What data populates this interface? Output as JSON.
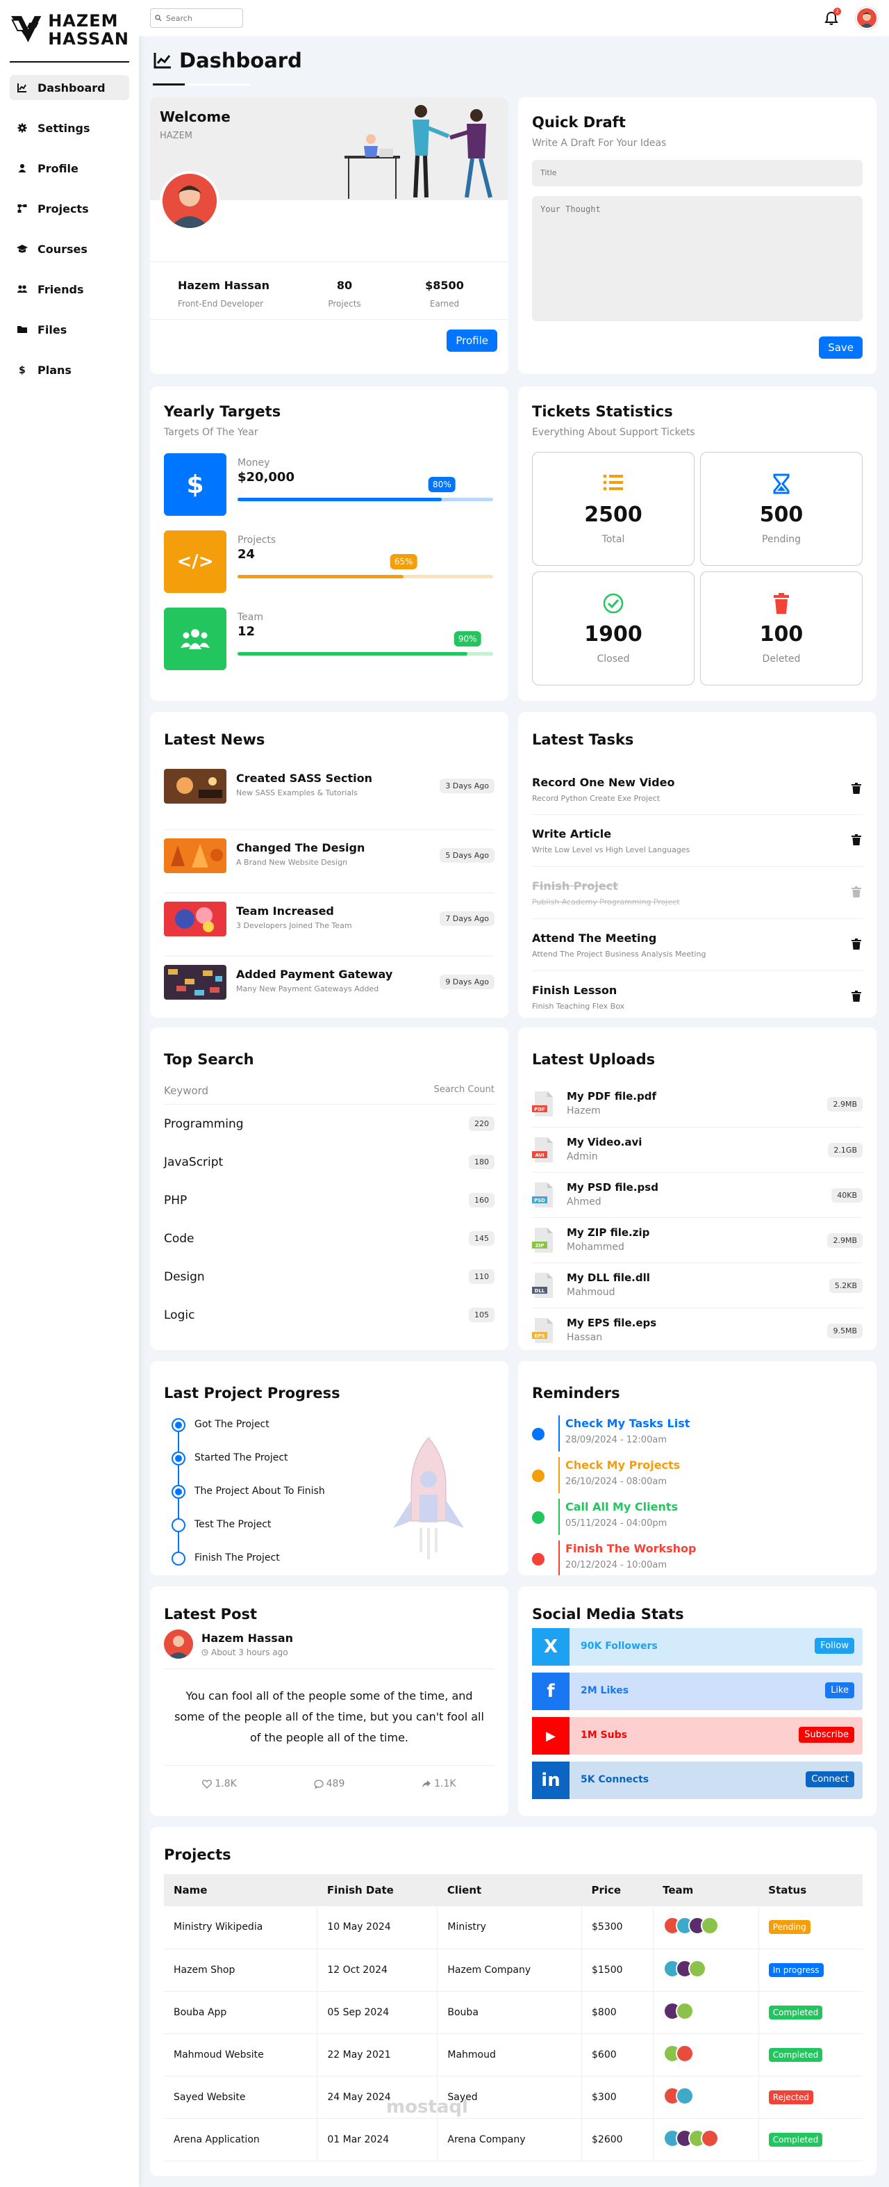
{
  "brand": {
    "line1": "HAZEM",
    "line2": "HASSAN"
  },
  "sidebar": {
    "items": [
      {
        "label": "Dashboard",
        "icon": "chart-line-icon"
      },
      {
        "label": "Settings",
        "icon": "gear-icon"
      },
      {
        "label": "Profile",
        "icon": "user-icon"
      },
      {
        "label": "Projects",
        "icon": "diagram-icon"
      },
      {
        "label": "Courses",
        "icon": "graduation-cap-icon"
      },
      {
        "label": "Friends",
        "icon": "users-icon"
      },
      {
        "label": "Files",
        "icon": "folder-icon"
      },
      {
        "label": "Plans",
        "icon": "dollar-icon"
      }
    ]
  },
  "search": {
    "placeholder": "Search"
  },
  "notifications": {
    "count": "2"
  },
  "page": {
    "title": "Dashboard"
  },
  "welcome": {
    "title": "Welcome",
    "subtitle": "HAZEM",
    "name": "Hazem Hassan",
    "role": "Front-End Developer",
    "projects_value": "80",
    "projects_label": "Projects",
    "earned_value": "$8500",
    "earned_label": "Earned",
    "button": "Profile"
  },
  "draft": {
    "title": "Quick Draft",
    "subtitle": "Write A Draft For Your Ideas",
    "title_placeholder": "Title",
    "body_placeholder": "Your Thought",
    "button": "Save"
  },
  "targets": {
    "title": "Yearly Targets",
    "subtitle": "Targets Of The Year",
    "items": [
      {
        "label": "Money",
        "value": "$20,000",
        "percent": 80,
        "pct_label": "80%",
        "color": "#0075ff",
        "track": "#b8d6fb",
        "icon": "$"
      },
      {
        "label": "Projects",
        "value": "24",
        "percent": 65,
        "pct_label": "65%",
        "color": "#f59e0b",
        "track": "#fbe3b9",
        "icon": "</>"
      },
      {
        "label": "Team",
        "value": "12",
        "percent": 90,
        "pct_label": "90%",
        "color": "#22c55e",
        "track": "#c6f0d4",
        "icon": "users"
      }
    ]
  },
  "tickets": {
    "title": "Tickets Statistics",
    "subtitle": "Everything About Support Tickets",
    "items": [
      {
        "value": "2500",
        "label": "Total",
        "color": "#f59e0b"
      },
      {
        "value": "500",
        "label": "Pending",
        "color": "#0075ff"
      },
      {
        "value": "1900",
        "label": "Closed",
        "color": "#22c55e"
      },
      {
        "value": "100",
        "label": "Deleted",
        "color": "#f44336"
      }
    ]
  },
  "news": {
    "title": "Latest News",
    "items": [
      {
        "title": "Created SASS Section",
        "desc": "New SASS Examples & Tutorials",
        "date": "3 Days Ago"
      },
      {
        "title": "Changed The Design",
        "desc": "A Brand New Website Design",
        "date": "5 Days Ago"
      },
      {
        "title": "Team Increased",
        "desc": "3 Developers Joined The Team",
        "date": "7 Days Ago"
      },
      {
        "title": "Added Payment Gateway",
        "desc": "Many New Payment Gateways Added",
        "date": "9 Days Ago"
      }
    ]
  },
  "tasks": {
    "title": "Latest Tasks",
    "items": [
      {
        "title": "Record One New Video",
        "desc": "Record Python Create Exe Project",
        "done": false
      },
      {
        "title": "Write Article",
        "desc": "Write Low Level vs High Level Languages",
        "done": false
      },
      {
        "title": "Finish Project",
        "desc": "Publish Academy Programming Project",
        "done": true
      },
      {
        "title": "Attend The Meeting",
        "desc": "Attend The Project Business Analysis Meeting",
        "done": false
      },
      {
        "title": "Finish Lesson",
        "desc": "Finish Teaching Flex Box",
        "done": false
      }
    ]
  },
  "top_search": {
    "title": "Top Search",
    "col1": "Keyword",
    "col2": "Search Count",
    "items": [
      {
        "keyword": "Programming",
        "count": "220"
      },
      {
        "keyword": "JavaScript",
        "count": "180"
      },
      {
        "keyword": "PHP",
        "count": "160"
      },
      {
        "keyword": "Code",
        "count": "145"
      },
      {
        "keyword": "Design",
        "count": "110"
      },
      {
        "keyword": "Logic",
        "count": "105"
      }
    ]
  },
  "uploads": {
    "title": "Latest Uploads",
    "items": [
      {
        "name": "My PDF file.pdf",
        "by": "Hazem",
        "size": "2.9MB",
        "ext": "PDF",
        "color": "#e74c3c"
      },
      {
        "name": "My Video.avi",
        "by": "Admin",
        "size": "2.1GB",
        "ext": "AVI",
        "color": "#e74c3c"
      },
      {
        "name": "My PSD file.psd",
        "by": "Ahmed",
        "size": "40KB",
        "ext": "PSD",
        "color": "#3ba6e0"
      },
      {
        "name": "My ZIP file.zip",
        "by": "Mohammed",
        "size": "2.9MB",
        "ext": "ZIP",
        "color": "#8bc34a"
      },
      {
        "name": "My DLL file.dll",
        "by": "Mahmoud",
        "size": "5.2KB",
        "ext": "DLL",
        "color": "#55607a"
      },
      {
        "name": "My EPS file.eps",
        "by": "Hassan",
        "size": "9.5MB",
        "ext": "EPS",
        "color": "#f0b33c"
      }
    ]
  },
  "progress": {
    "title": "Last Project Progress",
    "steps": [
      {
        "label": "Got The Project",
        "done": true
      },
      {
        "label": "Started The Project",
        "done": true
      },
      {
        "label": "The Project About To Finish",
        "done": true
      },
      {
        "label": "Test The Project",
        "done": false
      },
      {
        "label": "Finish The Project",
        "done": false
      }
    ]
  },
  "reminders": {
    "title": "Reminders",
    "items": [
      {
        "title": "Check My Tasks List",
        "date": "28/09/2024 - 12:00am",
        "color": "#0075ff"
      },
      {
        "title": "Check My Projects",
        "date": "26/10/2024 - 08:00am",
        "color": "#f59e0b"
      },
      {
        "title": "Call All My Clients",
        "date": "05/11/2024 - 04:00pm",
        "color": "#22c55e"
      },
      {
        "title": "Finish The Workshop",
        "date": "20/12/2024 - 10:00am",
        "color": "#f44336"
      }
    ]
  },
  "post": {
    "title": "Latest Post",
    "author": "Hazem Hassan",
    "time": "About 3 hours ago",
    "text": "You can fool all of the people some of the time, and some of the people all of the time, but you can't fool all of the people all of the time.",
    "likes": "1.8K",
    "comments": "489",
    "shares": "1.1K"
  },
  "social": {
    "title": "Social Media Stats",
    "items": [
      {
        "icon": "x-icon",
        "glyph": "X",
        "text": "90K Followers",
        "button": "Follow",
        "color": "#1da1f2",
        "bg": "#d3ebfb",
        "iconbg": "#1da1f2"
      },
      {
        "icon": "facebook-icon",
        "glyph": "f",
        "text": "2M Likes",
        "button": "Like",
        "color": "#1877f2",
        "bg": "#cfe0fc",
        "iconbg": "#1877f2"
      },
      {
        "icon": "youtube-icon",
        "glyph": "▶",
        "text": "1M Subs",
        "button": "Subscribe",
        "color": "#ff0000",
        "bg": "#fdcfcf",
        "iconbg": "#ff0000"
      },
      {
        "icon": "linkedin-icon",
        "glyph": "in",
        "text": "5K Connects",
        "button": "Connect",
        "color": "#0a66c2",
        "bg": "#cddff3",
        "iconbg": "#0a66c2"
      }
    ]
  },
  "projects": {
    "title": "Projects",
    "headers": [
      "Name",
      "Finish Date",
      "Client",
      "Price",
      "Team",
      "Status"
    ],
    "rows": [
      {
        "name": "Ministry Wikipedia",
        "date": "10 May 2024",
        "client": "Ministry",
        "price": "$5300",
        "team": 4,
        "status": "Pending",
        "color": "#f59e0b"
      },
      {
        "name": "Hazem Shop",
        "date": "12 Oct 2024",
        "client": "Hazem Company",
        "price": "$1500",
        "team": 3,
        "status": "In progress",
        "color": "#0075ff"
      },
      {
        "name": "Bouba App",
        "date": "05 Sep 2024",
        "client": "Bouba",
        "price": "$800",
        "team": 2,
        "status": "Completed",
        "color": "#22c55e"
      },
      {
        "name": "Mahmoud Website",
        "date": "22 May 2021",
        "client": "Mahmoud",
        "price": "$600",
        "team": 2,
        "status": "Completed",
        "color": "#22c55e"
      },
      {
        "name": "Sayed Website",
        "date": "24 May 2024",
        "client": "Sayed",
        "price": "$300",
        "team": 2,
        "status": "Rejected",
        "color": "#f44336"
      },
      {
        "name": "Arena Application",
        "date": "01 Mar 2024",
        "client": "Arena Company",
        "price": "$2600",
        "team": 4,
        "status": "Completed",
        "color": "#22c55e"
      }
    ]
  },
  "watermark": {
    "text": "mostaql"
  }
}
